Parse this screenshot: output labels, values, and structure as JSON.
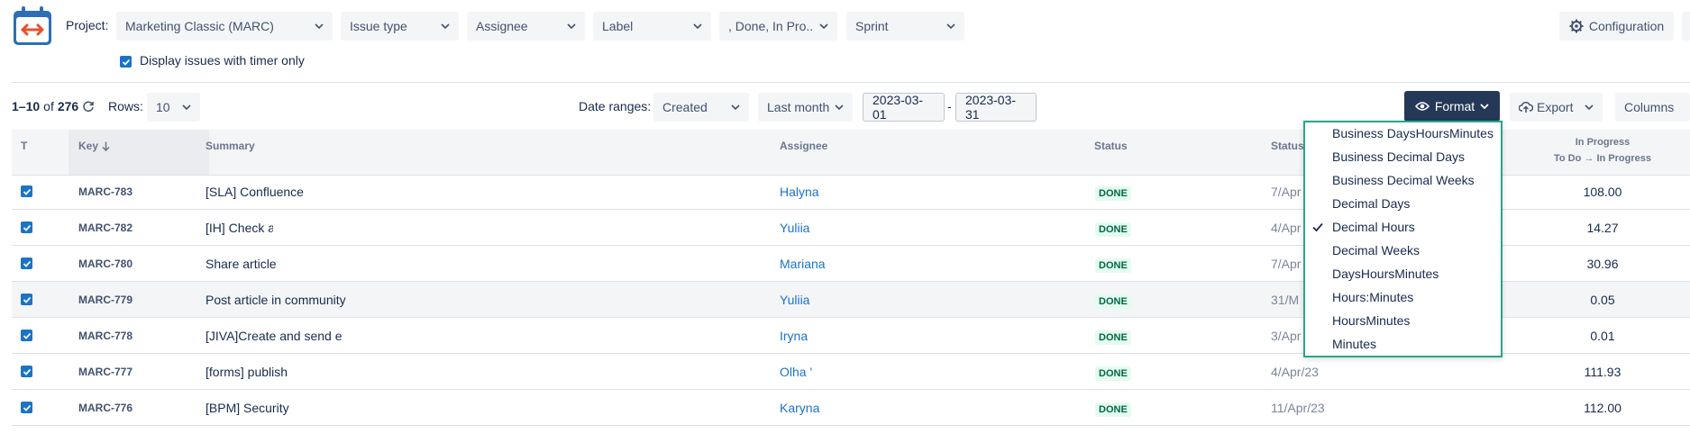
{
  "filters": {
    "project_label": "Project:",
    "project": "Marketing Classic (MARC)",
    "issue_type": "Issue type",
    "assignee": "Assignee",
    "label": "Label",
    "status": ", Done, In Pro...",
    "sprint": "Sprint",
    "configuration": "Configuration",
    "timer_only": "Display issues with timer only"
  },
  "toolbar": {
    "range_bold": "1–10",
    "of_label": "of",
    "total": "276",
    "rows_label": "Rows:",
    "rows_value": "10",
    "date_ranges_label": "Date ranges:",
    "date_field": "Created",
    "period": "Last month",
    "date_from": "2023-03-01",
    "date_sep": "-",
    "date_to": "2023-03-31",
    "format": "Format",
    "export": "Export",
    "columns": "Columns"
  },
  "table": {
    "headers": {
      "t": "T",
      "key": "Key",
      "summary": "Summary",
      "assignee": "Assignee",
      "status": "Status",
      "status2": "Status",
      "in_progress_1": "In Progress",
      "in_progress_2": "To Do → In Progress"
    },
    "rows": [
      {
        "key": "MARC-783",
        "summary": "[SLA] Confluence",
        "assignee": "Halyna",
        "status": "DONE",
        "date": "7/Apr",
        "value": "108.00"
      },
      {
        "key": "MARC-782",
        "summary": "[IH] Check a",
        "assignee": "Yuliia",
        "status": "DONE",
        "date": "4/Apr",
        "value": "14.27"
      },
      {
        "key": "MARC-780",
        "summary": "Share article",
        "assignee": "Mariana",
        "status": "DONE",
        "date": "7/Apr",
        "value": "30.96"
      },
      {
        "key": "MARC-779",
        "summary": "Post article in community",
        "assignee": "Yuliia",
        "status": "DONE",
        "date": "31/M",
        "value": "0.05"
      },
      {
        "key": "MARC-778",
        "summary": "[JIVA]Create and send e",
        "assignee": "Iryna",
        "status": "DONE",
        "date": "3/Apr",
        "value": "0.01"
      },
      {
        "key": "MARC-777",
        "summary": "[forms] publish",
        "assignee": "Olha '",
        "status": "DONE",
        "date": "4/Apr/23",
        "value": "111.93"
      },
      {
        "key": "MARC-776",
        "summary": "[BPM] Security",
        "assignee": "Karyna",
        "status": "DONE",
        "date": "11/Apr/23",
        "value": "112.00"
      }
    ]
  },
  "format_menu": {
    "items": [
      "Business DaysHoursMinutes",
      "Business Decimal Days",
      "Business Decimal Weeks",
      "Decimal Days",
      "Decimal Hours",
      "Decimal Weeks",
      "DaysHoursMinutes",
      "Hours:Minutes",
      "HoursMinutes",
      "Minutes"
    ],
    "selected": "Decimal Hours"
  },
  "colors": {
    "accent": "#1a73c7",
    "format_button": "#253858",
    "menu_border": "#2aa58a",
    "done_badge": "#e3fcef"
  }
}
